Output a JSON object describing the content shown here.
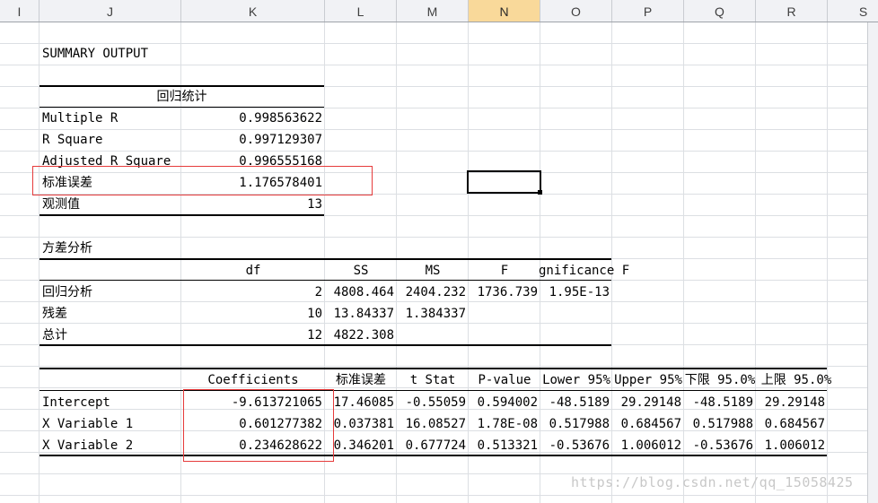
{
  "columns": [
    {
      "label": "I",
      "selected": false
    },
    {
      "label": "J",
      "selected": false
    },
    {
      "label": "K",
      "selected": false
    },
    {
      "label": "L",
      "selected": false
    },
    {
      "label": "M",
      "selected": false
    },
    {
      "label": "N",
      "selected": true
    },
    {
      "label": "O",
      "selected": false
    },
    {
      "label": "P",
      "selected": false
    },
    {
      "label": "Q",
      "selected": false
    },
    {
      "label": "R",
      "selected": false
    },
    {
      "label": "S",
      "selected": false
    }
  ],
  "summary": {
    "title": "SUMMARY OUTPUT",
    "reg_stats_header": "回归统计",
    "rows": [
      {
        "label": "Multiple R",
        "value": "0.998563622"
      },
      {
        "label": "R Square",
        "value": "0.997129307"
      },
      {
        "label": "Adjusted R Square",
        "value": "0.996555168"
      },
      {
        "label": "标准误差",
        "value": "1.176578401"
      },
      {
        "label": "观测值",
        "value": "13"
      }
    ]
  },
  "anova": {
    "title": "方差分析",
    "headers": {
      "df": "df",
      "ss": "SS",
      "ms": "MS",
      "f": "F",
      "sig": "gnificance F"
    },
    "rows": [
      {
        "label": "回归分析",
        "df": "2",
        "ss": "4808.464",
        "ms": "2404.232",
        "f": "1736.739",
        "sig": "1.95E-13"
      },
      {
        "label": "残差",
        "df": "10",
        "ss": "13.84337",
        "ms": "1.384337",
        "f": "",
        "sig": ""
      },
      {
        "label": "总计",
        "df": "12",
        "ss": "4822.308",
        "ms": "",
        "f": "",
        "sig": ""
      }
    ]
  },
  "coef": {
    "headers": {
      "coef": "Coefficients",
      "se": "标准误差",
      "t": "t Stat",
      "p": "P-value",
      "lower95": "Lower 95%",
      "upper95": "Upper 95%",
      "lower950": "下限 95.0%",
      "upper950": "上限 95.0%"
    },
    "rows": [
      {
        "label": "Intercept",
        "coef": "-9.613721065",
        "se": "17.46085",
        "t": "-0.55059",
        "p": "0.594002",
        "lower95": "-48.5189",
        "upper95": "29.29148",
        "lower950": "-48.5189",
        "upper950": "29.29148"
      },
      {
        "label": "X Variable 1",
        "coef": "0.601277382",
        "se": "0.037381",
        "t": "16.08527",
        "p": "1.78E-08",
        "lower95": "0.517988",
        "upper95": "0.684567",
        "lower950": "0.517988",
        "upper950": "0.684567"
      },
      {
        "label": "X Variable 2",
        "coef": "0.234628622",
        "se": "0.346201",
        "t": "0.677724",
        "p": "0.513321",
        "lower95": "-0.53676",
        "upper95": "1.006012",
        "lower950": "-0.53676",
        "upper950": "1.006012"
      }
    ]
  },
  "watermark": "https://blog.csdn.net/qq_15058425"
}
